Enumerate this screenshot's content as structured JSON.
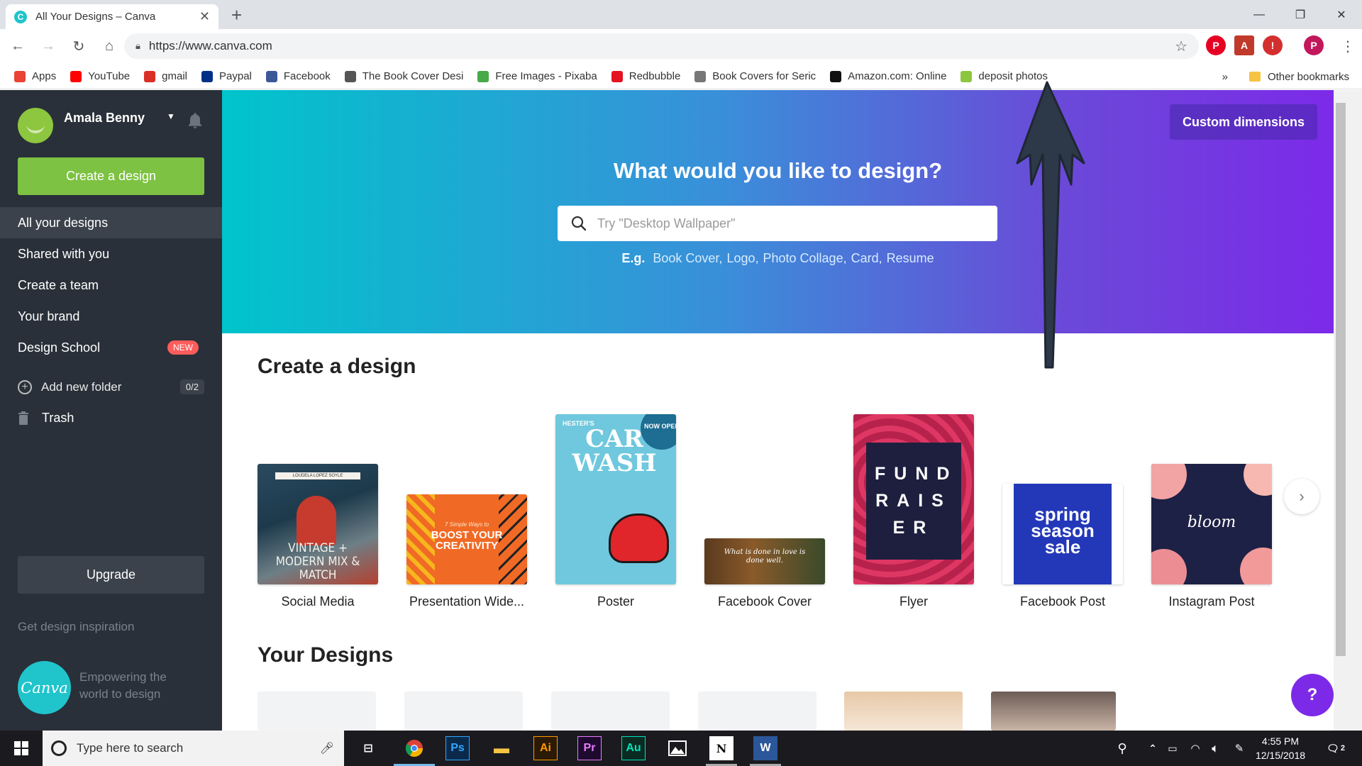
{
  "browser": {
    "tab_title": "All Your Designs – Canva",
    "url": "https://www.canva.com",
    "profile_initial": "P",
    "bookmarks": [
      {
        "label": "Apps",
        "color": "#e84335"
      },
      {
        "label": "YouTube",
        "color": "#ff0000"
      },
      {
        "label": "gmail",
        "color": "#d93025"
      },
      {
        "label": "Paypal",
        "color": "#003087"
      },
      {
        "label": "Facebook",
        "color": "#3b5998"
      },
      {
        "label": "The Book Cover Desi",
        "color": "#555555"
      },
      {
        "label": "Free Images - Pixaba",
        "color": "#48a947"
      },
      {
        "label": "Redbubble",
        "color": "#e41321"
      },
      {
        "label": "Book Covers for Seric",
        "color": "#777777"
      },
      {
        "label": "Amazon.com: Online",
        "color": "#111111"
      },
      {
        "label": "deposit photos",
        "color": "#8cc63f"
      }
    ],
    "bookmarks_overflow": "»",
    "other_bookmarks": "Other bookmarks"
  },
  "sidebar": {
    "user_name": "Amala Benny",
    "create_button": "Create a design",
    "nav": [
      {
        "label": "All your designs",
        "active": true
      },
      {
        "label": "Shared with you"
      },
      {
        "label": "Create a team"
      },
      {
        "label": "Your brand"
      },
      {
        "label": "Design School",
        "badge": "NEW"
      }
    ],
    "add_folder": "Add new folder",
    "folder_count": "0/2",
    "trash": "Trash",
    "upgrade": "Upgrade",
    "inspiration": "Get design inspiration",
    "logo_text": "Canva",
    "tagline": "Empowering the world to design"
  },
  "hero": {
    "custom_dimensions": "Custom dimensions",
    "title": "What would you like to design?",
    "search_placeholder": "Try \"Desktop Wallpaper\"",
    "examples_prefix": "E.g.",
    "examples": [
      "Book Cover",
      "Logo",
      "Photo Collage",
      "Card",
      "Resume"
    ]
  },
  "create_section": {
    "title": "Create a design",
    "cards": [
      {
        "label": "Social Media",
        "thumb_text": "VINTAGE + MODERN MIX & MATCH",
        "thumb_top": "LOUDELA LOPEZ SOYLE"
      },
      {
        "label": "Presentation Wide...",
        "thumb_text": "BOOST YOUR CREATIVITY",
        "thumb_top": "7 Simple Ways to"
      },
      {
        "label": "Poster",
        "thumb_text": "CAR WASH",
        "thumb_top": "HESTER'S",
        "thumb_badge": "NOW OPEN"
      },
      {
        "label": "Facebook Cover",
        "thumb_text": "What is done in love is done well."
      },
      {
        "label": "Flyer",
        "thumb_text": "FUND RAIS ER"
      },
      {
        "label": "Facebook Post",
        "thumb_text": "spring season sale"
      },
      {
        "label": "Instagram Post",
        "thumb_text": "bloom"
      }
    ]
  },
  "your_designs": {
    "title": "Your Designs"
  },
  "help": "?",
  "taskbar": {
    "search_placeholder": "Type here to search",
    "time": "4:55 PM",
    "date": "12/15/2018",
    "notifications": "2"
  }
}
